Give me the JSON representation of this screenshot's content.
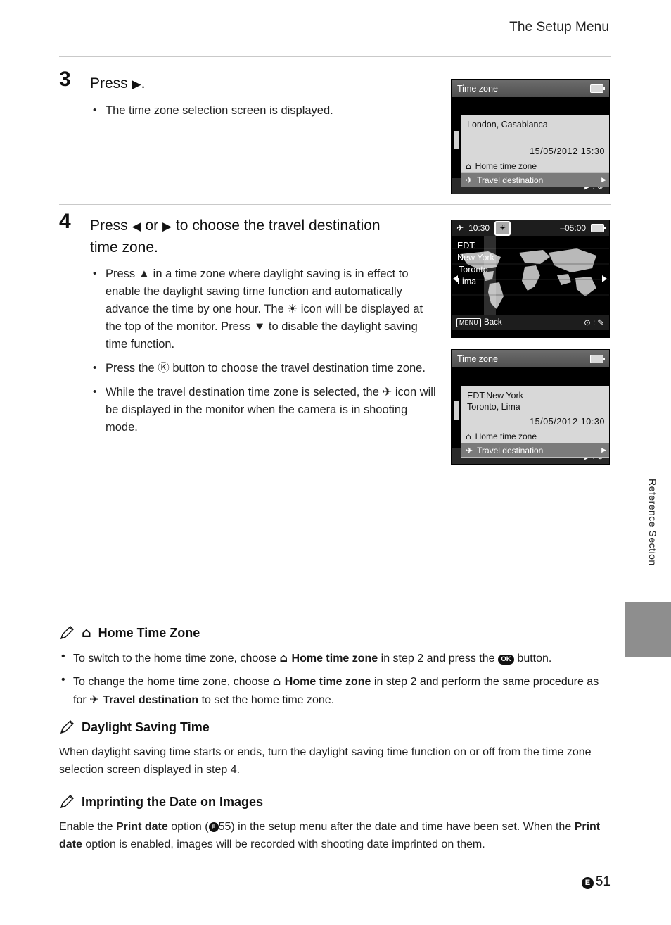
{
  "header": {
    "title": "The Setup Menu"
  },
  "steps": [
    {
      "num": "3",
      "title_prefix": "Press",
      "title_icon": "right-arrow",
      "title_suffix": ".",
      "bullets": [
        "The time zone selection screen is displayed."
      ]
    },
    {
      "num": "4",
      "title_line1_a": "Press",
      "title_line1_b": "or",
      "title_line1_c": "to choose the travel destination",
      "title_line2": "time zone.",
      "bullets": [
        "Press ▲ in a time zone where daylight saving is in effect to enable the daylight saving time function and automatically advance the time by one hour. The ☀ icon will be displayed at the top of the monitor. Press ▼ to disable the daylight saving time function.",
        "Press the Ⓚ button to choose the travel destination time zone.",
        "While the travel destination time zone is selected, the ✈ icon will be displayed in the monitor when the camera is in shooting mode."
      ]
    }
  ],
  "screens": {
    "timezone_home": {
      "title": "Time zone",
      "city": "London, Casablanca",
      "datetime": "15/05/2012 15:30",
      "rows": [
        {
          "label": "Home time zone",
          "icon": "house-icon",
          "selected": false
        },
        {
          "label": "Travel destination",
          "icon": "plane-icon",
          "selected": true
        }
      ],
      "footer_icons": "▶ : ⊕"
    },
    "world_map": {
      "time": "10:30",
      "offset": "–05:00",
      "zone_label": "EDT:",
      "cities": [
        "New York",
        "Toronto",
        "Lima"
      ],
      "back_label": "Back",
      "menu_badge": "MENU",
      "footer_icons": "⊙ : ✎"
    },
    "timezone_travel": {
      "title": "Time zone",
      "city_line1": "EDT:New York",
      "city_line2": "Toronto, Lima",
      "datetime": "15/05/2012 10:30",
      "rows": [
        {
          "label": "Home time zone",
          "icon": "house-icon",
          "selected": false
        },
        {
          "label": "Travel destination",
          "icon": "plane-icon",
          "selected": true
        }
      ],
      "footer_icons": "▶ : ⊕"
    }
  },
  "notes": [
    {
      "id": "home-time-zone",
      "icon": "pencil-icon",
      "title_icon": "house-icon",
      "title": "Home Time Zone",
      "bullets": [
        {
          "parts": [
            {
              "t": "To switch to the home time zone, choose ",
              "b": false
            },
            {
              "t": "⌂ ",
              "b": true
            },
            {
              "t": "Home time zone",
              "b": true
            },
            {
              "t": " in step 2 and press the ",
              "b": false
            },
            {
              "t": "Ⓚ",
              "b": false,
              "ok": true
            },
            {
              "t": " button.",
              "b": false
            }
          ]
        },
        {
          "parts": [
            {
              "t": "To change the home time zone, choose ",
              "b": false
            },
            {
              "t": "⌂ ",
              "b": true
            },
            {
              "t": "Home time zone",
              "b": true
            },
            {
              "t": " in step 2 and perform the same procedure as for ",
              "b": false
            },
            {
              "t": "✈ ",
              "b": true
            },
            {
              "t": "Travel destination",
              "b": true
            },
            {
              "t": " to set the home time zone.",
              "b": false
            }
          ]
        }
      ]
    },
    {
      "id": "daylight-saving-time",
      "icon": "pencil-icon",
      "title": "Daylight Saving Time",
      "body": "When daylight saving time starts or ends, turn the daylight saving time function on or off from the time zone selection screen displayed in step 4."
    },
    {
      "id": "imprinting-date",
      "icon": "pencil-icon",
      "title": "Imprinting the Date on Images",
      "body_parts": [
        {
          "t": "Enable the ",
          "b": false
        },
        {
          "t": "Print date",
          "b": true
        },
        {
          "t": " option (",
          "b": false
        },
        {
          "t": "E",
          "b": false,
          "badge": true
        },
        {
          "t": "55) in the setup menu after the date and time have been set. When the ",
          "b": false
        },
        {
          "t": "Print date",
          "b": true
        },
        {
          "t": " option is enabled, images will be recorded with shooting date imprinted on them.",
          "b": false
        }
      ]
    }
  ],
  "side_tab_label": "Reference Section",
  "page_number": {
    "badge": "E",
    "number": "51"
  }
}
